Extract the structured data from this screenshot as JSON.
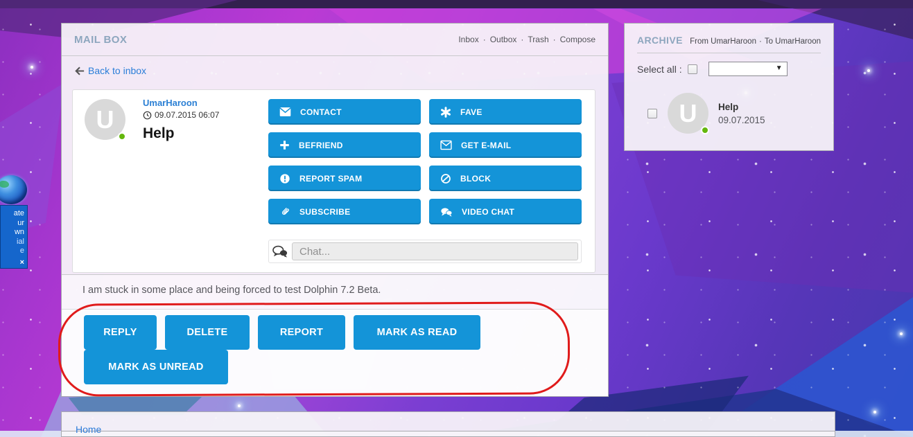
{
  "mailbox": {
    "title": "MAIL BOX",
    "tabs": [
      "Inbox",
      "Outbox",
      "Trash",
      "Compose"
    ],
    "tab_separator": "·",
    "back_link": "Back to inbox",
    "message": {
      "sender": "UmarHaroon",
      "avatar_letter": "U",
      "date": "09.07.2015 06:07",
      "subject": "Help",
      "body": "I am stuck in some place and being forced to test Dolphin 7.2 Beta."
    },
    "profile_buttons": [
      {
        "label": "CONTACT",
        "icon": "envelope-icon"
      },
      {
        "label": "FAVE",
        "icon": "asterisk-icon"
      },
      {
        "label": "BEFRIEND",
        "icon": "plus-icon"
      },
      {
        "label": "GET E-MAIL",
        "icon": "envelope-outline-icon"
      },
      {
        "label": "REPORT SPAM",
        "icon": "exclamation-circle-icon"
      },
      {
        "label": "BLOCK",
        "icon": "block-icon"
      },
      {
        "label": "SUBSCRIBE",
        "icon": "paperclip-icon"
      },
      {
        "label": "VIDEO CHAT",
        "icon": "chat-bubbles-icon"
      }
    ],
    "chat_placeholder": "Chat...",
    "action_buttons_row1": [
      "REPLY",
      "DELETE",
      "REPORT",
      "MARK AS READ"
    ],
    "action_buttons_row2": [
      "MARK AS UNREAD"
    ]
  },
  "archive": {
    "title": "ARCHIVE",
    "from_label": "From UmarHaroon",
    "separator": "·",
    "to_label": "To UmarHaroon",
    "select_all_label": "Select all :",
    "item": {
      "subject": "Help",
      "date": "09.07.2015",
      "avatar_letter": "U"
    }
  },
  "footer": {
    "home_label": "Home"
  },
  "ad_widget": {
    "visible_text_lines": [
      "ate",
      "ur",
      "wn",
      "ial",
      "e"
    ],
    "close_glyph": "×"
  },
  "colors": {
    "button_blue": "#1494d8",
    "panel_title": "#8da6be",
    "link_blue": "#2a7ed8",
    "online_green": "#64b70d",
    "annotation_red": "#e01b1b"
  }
}
